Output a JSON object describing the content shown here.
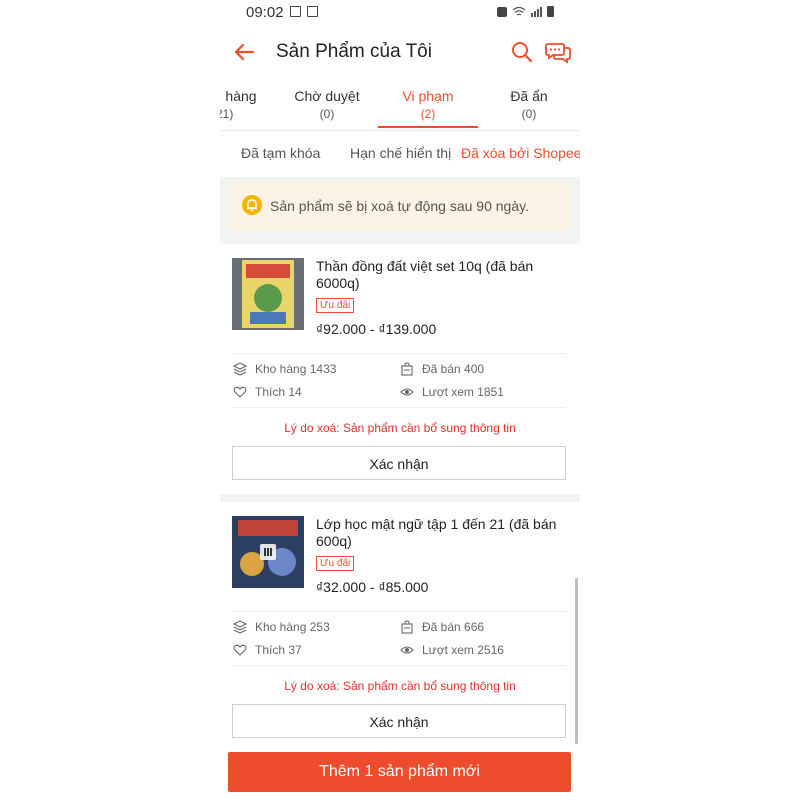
{
  "status_bar": {
    "time": "09:02"
  },
  "app_bar": {
    "title": "Sản Phẩm của Tôi"
  },
  "tabs": [
    {
      "label": "hàng",
      "count": "21)"
    },
    {
      "label": "Chờ duyệt",
      "count": "(0)"
    },
    {
      "label": "Vi phạm",
      "count": "(2)"
    },
    {
      "label": "Đã ẩn",
      "count": "(0)"
    }
  ],
  "subtabs": [
    "Đã tạm khóa",
    "Hạn chế hiển thị",
    "Đã xóa bởi Shopee"
  ],
  "notice": "Sản phẩm sẽ bị xoá tự động sau 90 ngày.",
  "products": [
    {
      "name": "Thần đồng đất việt set 10q (đã bán 6000q)",
      "promo": "Ưu đãi",
      "price": "₫92.000 - ₫139.000",
      "stock": "Kho hàng 1433",
      "sold": "Đã bán 400",
      "likes": "Thích 14",
      "views": "Lượt xem 1851",
      "reason": "Lý do xoá: Sản phẩm cần bổ sung thông tin",
      "confirm": "Xác nhận"
    },
    {
      "name": "Lớp học mật ngữ tập 1 đến 21 (đã bán 600q)",
      "promo": "Ưu đãi",
      "price": "₫32.000 - ₫85.000",
      "stock": "Kho hàng 253",
      "sold": "Đã bán 666",
      "likes": "Thích 37",
      "views": "Lượt xem 2516",
      "reason": "Lý do xoá: Sản phẩm cần bổ sung thông tin",
      "confirm": "Xác nhận"
    }
  ],
  "add_button": "Thêm 1 sản phẩm mới",
  "colors": {
    "accent": "#ee4d2d",
    "notice_bg": "#fbf3e3",
    "reason": "#e0302b"
  }
}
